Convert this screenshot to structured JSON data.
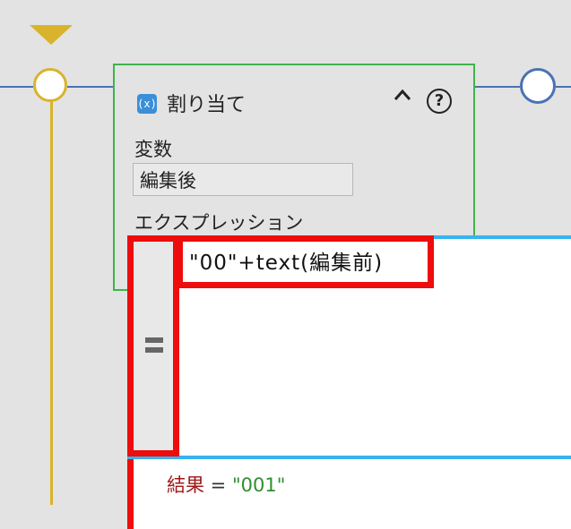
{
  "card": {
    "icon_text": "(x)",
    "title": "割り当て",
    "collapse_icon": "chevron-up-icon",
    "help_icon": "help-icon",
    "help_glyph": "?",
    "variable_label": "変数",
    "variable_value": "編集後",
    "expression_label": "エクスプレッション"
  },
  "editor": {
    "code": "\"00\"+text(編集前)"
  },
  "result": {
    "key": "結果",
    "operator": " = ",
    "value": "\"001\""
  },
  "colors": {
    "highlight": "#ee0c0c",
    "card_border": "#3fb44a",
    "flow_blue": "#4a72b4",
    "flow_gold": "#d9b32c",
    "editor_border": "#36b4ee"
  }
}
